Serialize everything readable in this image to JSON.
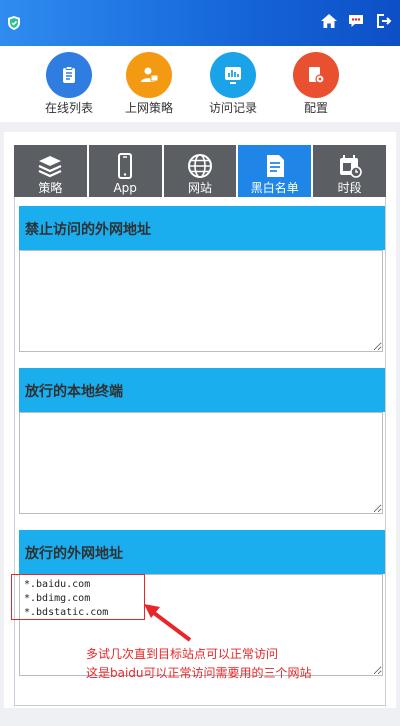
{
  "header": {
    "icons": [
      "shield-icon",
      "home-icon",
      "message-icon",
      "logout-icon"
    ],
    "colors": {
      "bar": "#1a6fe0"
    }
  },
  "nav": {
    "items": [
      {
        "label": "在线列表",
        "icon": "clipboard-icon",
        "color": "#2f7de1"
      },
      {
        "label": "上网策略",
        "icon": "user-card-icon",
        "color": "#f39a12"
      },
      {
        "label": "访问记录",
        "icon": "chart-icon",
        "color": "#1aa3e8"
      },
      {
        "label": "配置",
        "icon": "settings-icon",
        "color": "#e8502f"
      }
    ]
  },
  "tabs": {
    "items": [
      {
        "label": "策略",
        "icon": "layers-icon"
      },
      {
        "label": "App",
        "icon": "phone-icon"
      },
      {
        "label": "网站",
        "icon": "globe-icon"
      },
      {
        "label": "黑白名单",
        "icon": "list-icon",
        "active": true
      },
      {
        "label": "时段",
        "icon": "calendar-clock-icon"
      }
    ]
  },
  "sections": {
    "blocked": {
      "title": "禁止访问的外网地址",
      "value": ""
    },
    "local": {
      "title": "放行的本地终端",
      "value": ""
    },
    "allowed": {
      "title": "放行的外网地址",
      "value": "*.baidu.com\n*.bdimg.com\n*.bdstatic.com"
    }
  },
  "annotation": {
    "line1": "多试几次直到目标站点可以正常访问",
    "line2": "这是baidu可以正常访问需要用的三个网站",
    "color": "#e8262a"
  }
}
